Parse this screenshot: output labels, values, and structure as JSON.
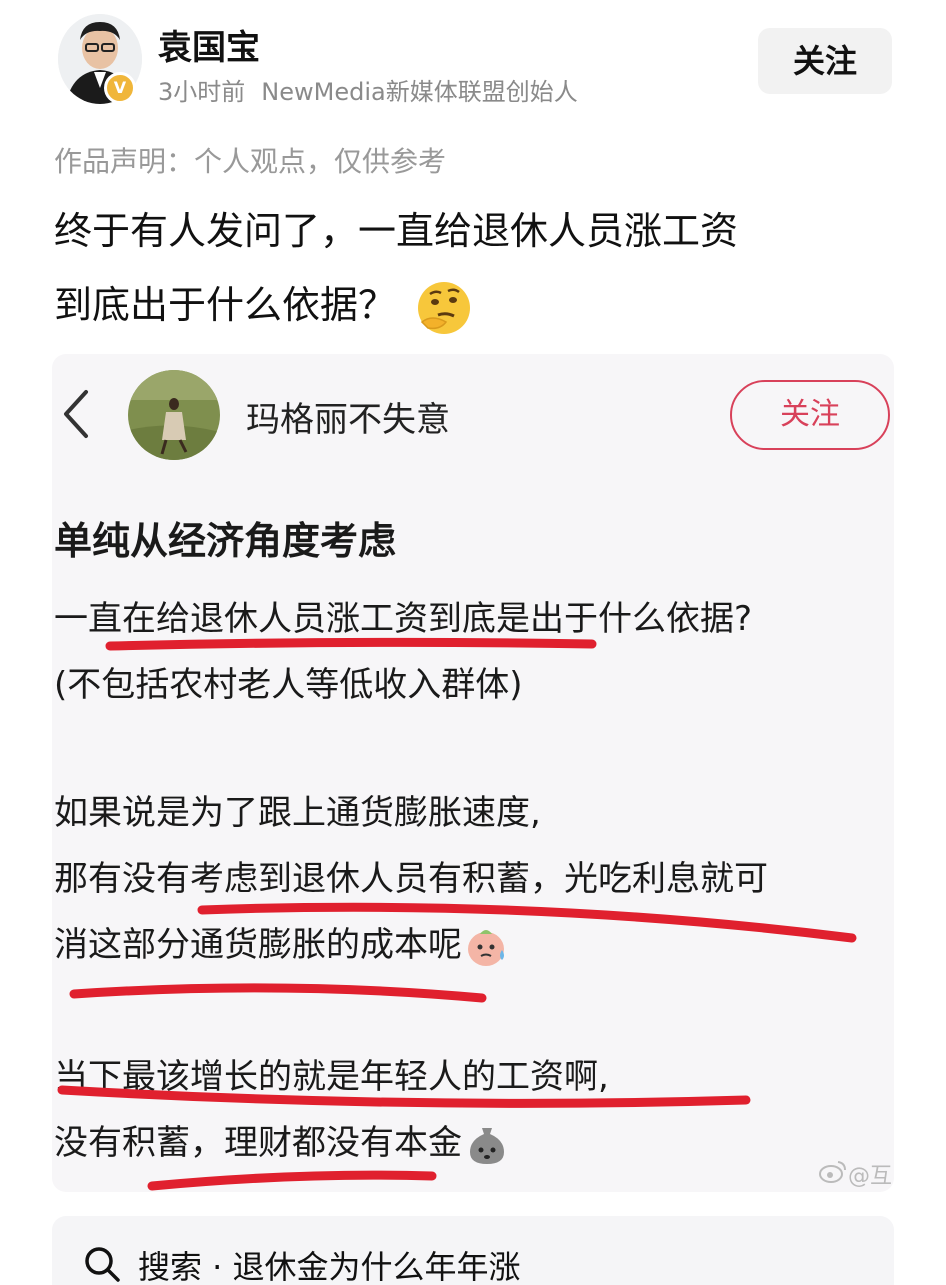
{
  "author": {
    "name": "袁国宝",
    "time": "3小时前",
    "description": "NewMedia新媒体联盟创始人",
    "verified_mark": "V"
  },
  "header": {
    "follow_label": "关注"
  },
  "post": {
    "declaration": "作品声明：个人观点，仅供参考",
    "title_line1": "终于有人发问了，一直给退休人员涨工资",
    "title_line2": "到底出于什么依据？"
  },
  "embedded": {
    "user_name": "玛格丽不失意",
    "follow_label": "关注",
    "heading": "单纯从经济角度考虑",
    "lines": [
      "一直在给退休人员涨工资到底是出于什么依据?",
      "(不包括农村老人等低收入群体)",
      "如果说是为了跟上通货膨胀速度,",
      "那有没有考虑到退休人员有积蓄，光吃利息就可",
      "消这部分通货膨胀的成本呢",
      "当下最该增长的就是年轻人的工资啊,",
      "没有积蓄，理财都没有本金"
    ],
    "watermark": "@互"
  },
  "search": {
    "label": "搜索 · 退休金为什么年年涨"
  },
  "colors": {
    "accent_red": "#d8415a",
    "underline_red": "#e0202e",
    "verified_gold": "#f0b63a"
  }
}
